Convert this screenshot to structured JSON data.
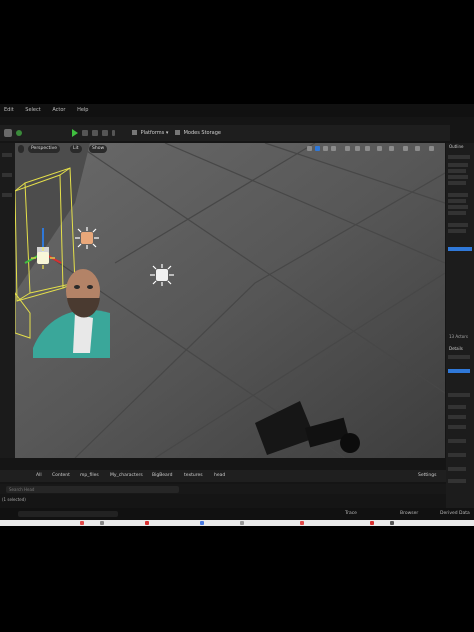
{
  "menu": {
    "items": [
      "Edit",
      "Select",
      "Actor",
      "Help"
    ]
  },
  "toolbar": {
    "platforms_label": "Platforms",
    "modeling_label": "Modes Storage"
  },
  "viewport": {
    "perspective_label": "Perspective",
    "lit_label": "Lit",
    "show_label": "Show"
  },
  "right_panel": {
    "outliner_label": "Outline",
    "details_label": "Details",
    "actors_count": "13 Actors"
  },
  "content_browser": {
    "breadcrumb": [
      "All",
      "Content",
      "mp_files",
      "My_characters",
      "BigBeard",
      "textures",
      "head"
    ],
    "settings_label": "Settings",
    "search_placeholder": "Search Head",
    "selection_text": "(1 selected)"
  },
  "status_bar": {
    "trace_label": "Trace",
    "derived_data_label": "Derived Data",
    "browser_label": "Browser"
  },
  "colors": {
    "play": "#3fbf3f",
    "selection": "#e5e04a",
    "accent_blue": "#2f78d8"
  }
}
